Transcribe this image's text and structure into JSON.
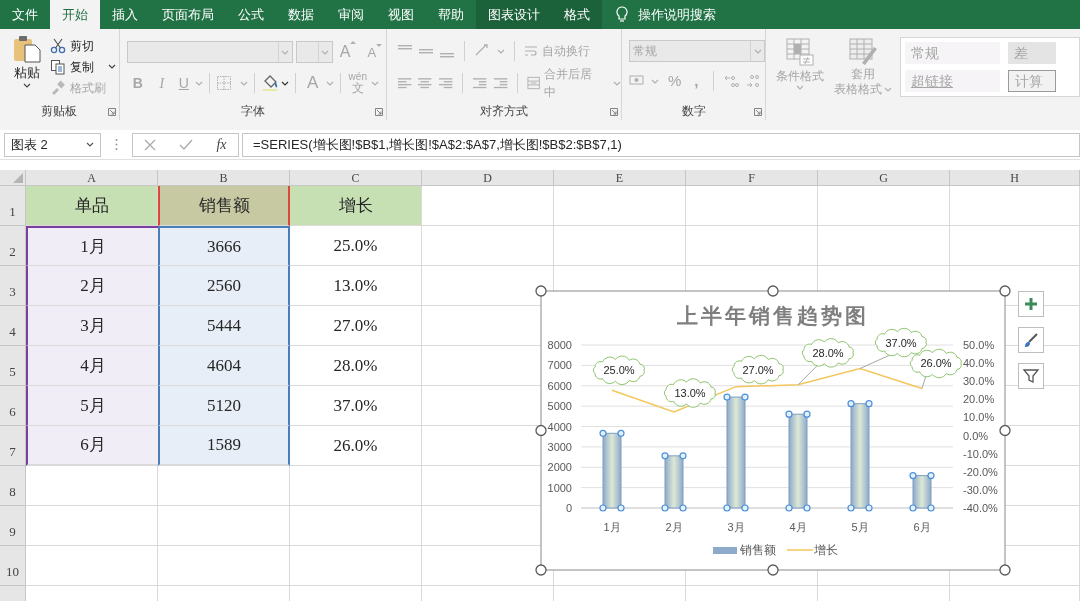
{
  "ribbon_tabs": [
    {
      "label": "文件",
      "selected": false,
      "contextual": false
    },
    {
      "label": "开始",
      "selected": true,
      "contextual": false
    },
    {
      "label": "插入",
      "selected": false,
      "contextual": false
    },
    {
      "label": "页面布局",
      "selected": false,
      "contextual": false
    },
    {
      "label": "公式",
      "selected": false,
      "contextual": false
    },
    {
      "label": "数据",
      "selected": false,
      "contextual": false
    },
    {
      "label": "审阅",
      "selected": false,
      "contextual": false
    },
    {
      "label": "视图",
      "selected": false,
      "contextual": false
    },
    {
      "label": "帮助",
      "selected": false,
      "contextual": false
    },
    {
      "label": "图表设计",
      "selected": false,
      "contextual": true
    },
    {
      "label": "格式",
      "selected": false,
      "contextual": true
    }
  ],
  "tell_me": "操作说明搜索",
  "ribbon": {
    "groups": [
      {
        "kind": "clipboard",
        "label": "剪贴板",
        "paste": "粘贴",
        "items": [
          {
            "kind": "cut",
            "label": "剪切",
            "disabled": false
          },
          {
            "kind": "copy",
            "label": "复制",
            "disabled": false
          },
          {
            "kind": "painter",
            "label": "格式刷",
            "disabled": true
          }
        ]
      },
      {
        "kind": "font",
        "label": "字体",
        "disabled": true,
        "grow": "A",
        "shrink": "A",
        "bold": "B",
        "italic": "I",
        "underline": "U",
        "font_color": "A",
        "phonetic_ruby": "wén",
        "phonetic_base": "文"
      },
      {
        "kind": "alignment",
        "label": "对齐方式",
        "disabled": true,
        "wrap": "自动换行",
        "merge": "合并后居中"
      },
      {
        "kind": "number",
        "label": "数字",
        "disabled": true,
        "format": "常规",
        "percent": "%",
        "comma": ","
      },
      {
        "kind": "styles",
        "disabled": true,
        "conditional": "条件格式",
        "table_line1": "套用",
        "table_line2": "表格格式",
        "gallery": [
          {
            "label": "常规",
            "kind": "normal"
          },
          {
            "label": "差",
            "kind": "bad"
          },
          {
            "label": "超链接",
            "kind": "hyperlink"
          },
          {
            "label": "计算",
            "kind": "calc"
          }
        ]
      }
    ]
  },
  "formula_bar": {
    "name_box": "图表 2",
    "fx": "fx",
    "formula": "=SERIES(增长图!$B$1,增长图!$A$2:$A$7,增长图!$B$2:$B$7,1)"
  },
  "sheet": {
    "columns": [
      "A",
      "B",
      "C",
      "D",
      "E",
      "F",
      "G",
      "H"
    ],
    "rows": [
      {
        "label": "1",
        "cells": [
          {
            "text": "单品",
            "kind": "header"
          },
          {
            "text": "销售额",
            "kind": "series_name"
          },
          {
            "text": "增长",
            "kind": "header"
          }
        ]
      },
      {
        "label": "2",
        "cells": [
          {
            "text": "1月",
            "kind": "category"
          },
          {
            "text": "3666",
            "kind": "value"
          },
          {
            "text": "25.0%",
            "kind": "plain"
          }
        ]
      },
      {
        "label": "3",
        "cells": [
          {
            "text": "2月",
            "kind": "category"
          },
          {
            "text": "2560",
            "kind": "value"
          },
          {
            "text": "13.0%",
            "kind": "plain"
          }
        ]
      },
      {
        "label": "4",
        "cells": [
          {
            "text": "3月",
            "kind": "category"
          },
          {
            "text": "5444",
            "kind": "value"
          },
          {
            "text": "27.0%",
            "kind": "plain"
          }
        ]
      },
      {
        "label": "5",
        "cells": [
          {
            "text": "4月",
            "kind": "category"
          },
          {
            "text": "4604",
            "kind": "value"
          },
          {
            "text": "28.0%",
            "kind": "plain"
          }
        ]
      },
      {
        "label": "6",
        "cells": [
          {
            "text": "5月",
            "kind": "category"
          },
          {
            "text": "5120",
            "kind": "value"
          },
          {
            "text": "37.0%",
            "kind": "plain"
          }
        ]
      },
      {
        "label": "7",
        "cells": [
          {
            "text": "6月",
            "kind": "category"
          },
          {
            "text": "1589",
            "kind": "value"
          },
          {
            "text": "26.0%",
            "kind": "plain"
          }
        ]
      },
      {
        "label": "8"
      },
      {
        "label": "9"
      },
      {
        "label": "10"
      }
    ]
  },
  "chart": {
    "chart_data": {
      "type": "bar",
      "title": "上半年销售趋势图",
      "categories": [
        "1月",
        "2月",
        "3月",
        "4月",
        "5月",
        "6月"
      ],
      "series": [
        {
          "name": "销售额",
          "color": "#8eaacb",
          "values": [
            3666,
            2560,
            5444,
            4604,
            5120,
            1589
          ]
        },
        {
          "name": "增长",
          "color": "#f2c75c",
          "type": "line",
          "axis": "y2",
          "values": [
            25,
            13,
            27,
            28,
            37,
            26
          ]
        }
      ],
      "ylim": [
        0,
        8000
      ],
      "yticks": [
        0,
        1000,
        2000,
        3000,
        4000,
        5000,
        6000,
        7000,
        8000
      ],
      "y2lim": [
        -40,
        50
      ],
      "y2ticks": [
        {
          "value": -40,
          "label": "-40.0%"
        },
        {
          "value": -30,
          "label": "-30.0%"
        },
        {
          "value": -20,
          "label": "-20.0%"
        },
        {
          "value": -10,
          "label": "-10.0%"
        },
        {
          "value": 0,
          "label": "0.0%"
        },
        {
          "value": 10,
          "label": "10.0%"
        },
        {
          "value": 20,
          "label": "20.0%"
        },
        {
          "value": 30,
          "label": "30.0%"
        },
        {
          "value": 40,
          "label": "40.0%"
        },
        {
          "value": 50,
          "label": "50.0%"
        }
      ],
      "grid": true,
      "legend": "bottom",
      "value_labels": [
        "25.0%",
        "13.0%",
        "27.0%",
        "28.0%",
        "37.0%",
        "26.0%"
      ]
    }
  }
}
